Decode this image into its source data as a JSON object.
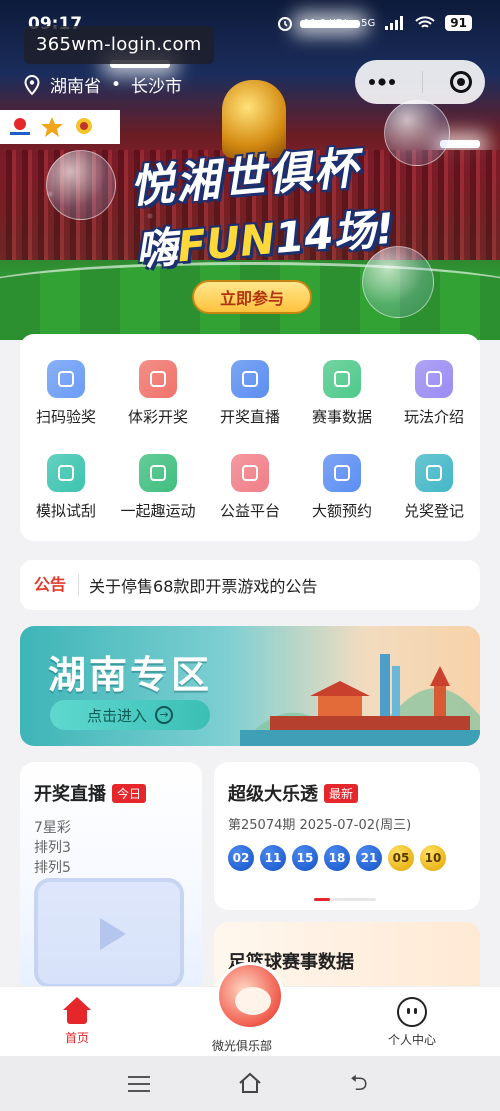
{
  "status": {
    "time": "09:17",
    "speed": "11.0 KB/s",
    "network": "5G",
    "battery": "91"
  },
  "browser_overlay": {
    "url": "365wm-login.com"
  },
  "location": {
    "province": "湖南省",
    "separator": "•",
    "city": "长沙市"
  },
  "hero": {
    "title_line1": "悦湘世俱杯",
    "title_line2_a": "嗨",
    "title_line2_b": "FUN",
    "title_line2_c": "14场!",
    "join_button": "立即参与"
  },
  "features": [
    {
      "label": "扫码验奖",
      "icon": "scan-icon",
      "color": "#6b9cf5"
    },
    {
      "label": "体彩开奖",
      "icon": "lottery-ball-icon",
      "color": "#f0736b"
    },
    {
      "label": "开奖直播",
      "icon": "live-icon",
      "color": "#5b8ff0"
    },
    {
      "label": "赛事数据",
      "icon": "chart-icon",
      "color": "#4fc98a"
    },
    {
      "label": "玩法介绍",
      "icon": "document-icon",
      "color": "#9b8cf3"
    },
    {
      "label": "模拟试刮",
      "icon": "scratch-card-icon",
      "color": "#3dc4b0"
    },
    {
      "label": "一起趣运动",
      "icon": "sports-icon",
      "color": "#3fbf7f"
    },
    {
      "label": "公益平台",
      "icon": "heart-icon",
      "color": "#f07f88"
    },
    {
      "label": "大额预约",
      "icon": "yuan-icon",
      "color": "#5c8ef2"
    },
    {
      "label": "兑奖登记",
      "icon": "register-icon",
      "color": "#44b7c7"
    }
  ],
  "notice": {
    "tag": "公告",
    "text": "关于停售68款即开票游戏的公告"
  },
  "hunan_zone": {
    "title": "湖南专区",
    "button": "点击进入"
  },
  "live_card": {
    "title": "开奖直播",
    "badge": "今日",
    "games": [
      "7星彩",
      "排列3",
      "排列5"
    ]
  },
  "lotto_card": {
    "title": "超级大乐透",
    "badge": "最新",
    "issue": "第25074期 2025-07-02(周三)",
    "front": [
      "02",
      "11",
      "15",
      "18",
      "21"
    ],
    "back": [
      "05",
      "10"
    ]
  },
  "football_card": {
    "title": "足篮球赛事数据"
  },
  "tabbar": {
    "home": "首页",
    "club": "微光俱乐部",
    "user": "个人中心"
  }
}
